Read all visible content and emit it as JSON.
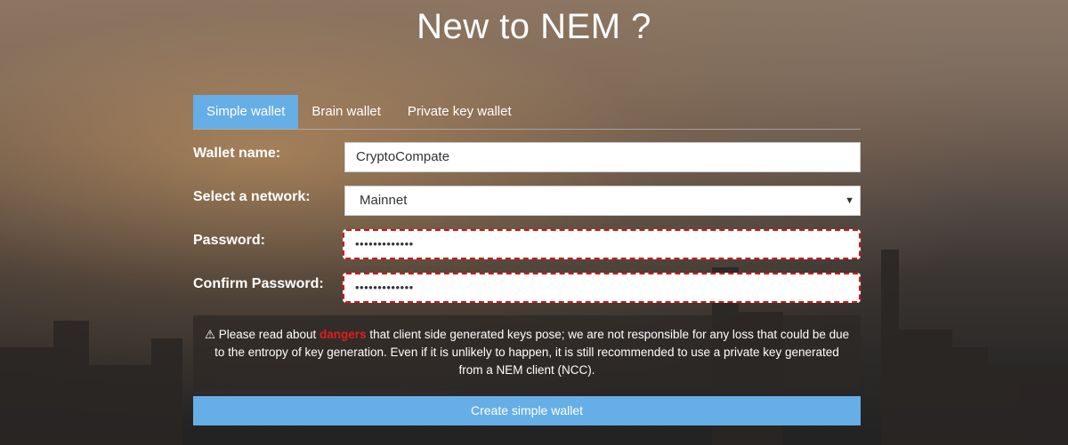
{
  "header": {
    "title": "New to NEM ?"
  },
  "tabs": [
    {
      "label": "Simple wallet",
      "active": true
    },
    {
      "label": "Brain wallet",
      "active": false
    },
    {
      "label": "Private key wallet",
      "active": false
    }
  ],
  "form": {
    "wallet_name_label": "Wallet name:",
    "wallet_name_value": "CryptoCompate",
    "network_label": "Select a network:",
    "network_selected": "Mainnet",
    "password_label": "Password:",
    "password_value": "•••••••••••••",
    "confirm_label": "Confirm Password:",
    "confirm_value": "•••••••••••••"
  },
  "warning": {
    "prefix": "Please read about",
    "link": "dangers",
    "text": "that client side generated keys pose; we are not responsible for any loss that could be due to the entropy of key generation. Even if it is unlikely to happen, it is still recommended to use a private key generated from a NEM client (NCC)."
  },
  "create_button": {
    "label": "Create simple wallet"
  },
  "colors": {
    "accent": "#66aee6",
    "error_border": "#d41515",
    "danger_text": "#e21d1d"
  }
}
